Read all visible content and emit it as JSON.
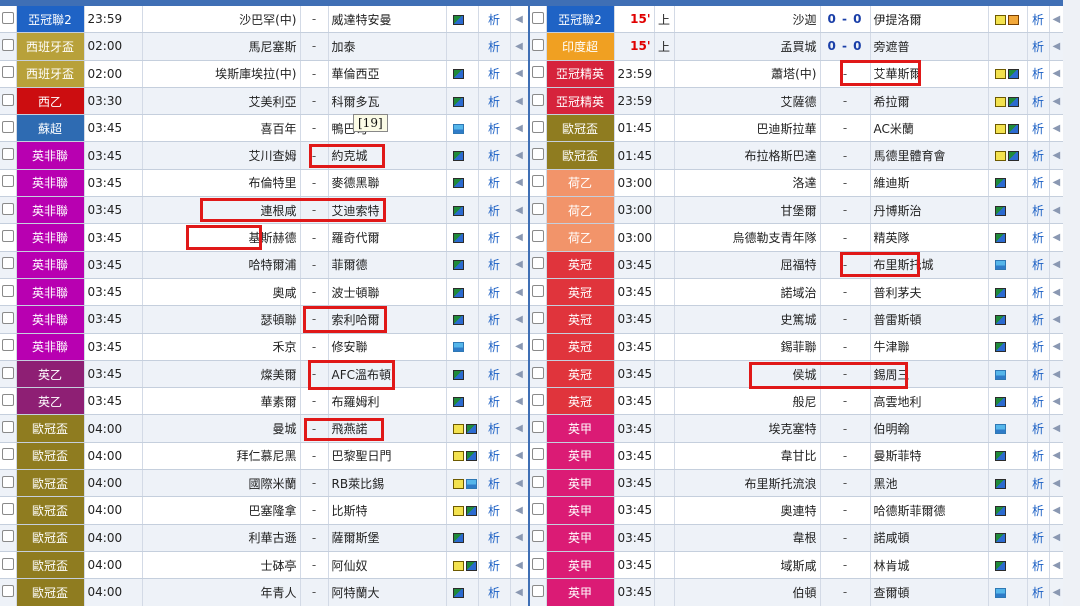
{
  "colors": {
    "亞冠聯2": "#1f63c5",
    "西班牙盃": "#b8a13a",
    "西乙": "#cc0d10",
    "蘇超": "#2e6bb2",
    "英非聯": "#b800b1",
    "英乙": "#8e1f74",
    "歐冠盃": "#8f7c20",
    "印度超": "#f0a022",
    "亞冠精英": "#d6233c",
    "荷乙": "#f2946a",
    "英冠": "#e0343c",
    "英甲": "#db1b75"
  },
  "tooltip": "[19]",
  "left_rows": [
    {
      "league": "亞冠聯2",
      "time": "23:59",
      "home": "沙巴罕(中)",
      "sep": "-",
      "away": "威達特安曼",
      "icons": [
        "field-icon"
      ],
      "analysis": "析"
    },
    {
      "league": "西班牙盃",
      "time": "02:00",
      "home": "馬尼塞斯",
      "sep": "-",
      "away": "加泰",
      "icons": [],
      "analysis": "析"
    },
    {
      "league": "西班牙盃",
      "time": "02:00",
      "home": "埃斯庫埃拉(中)",
      "sep": "-",
      "away": "華倫西亞",
      "icons": [
        "field-icon"
      ],
      "analysis": "析"
    },
    {
      "league": "西乙",
      "time": "03:30",
      "home": "艾美利亞",
      "sep": "-",
      "away": "科爾多瓦",
      "icons": [
        "field-icon"
      ],
      "analysis": "析"
    },
    {
      "league": "蘇超",
      "time": "03:45",
      "home": "喜百年",
      "sep": "-",
      "away": "鴨巴甸",
      "icons": [
        "sky-icon"
      ],
      "analysis": "析"
    },
    {
      "league": "英非聯",
      "time": "03:45",
      "home": "艾川查姆",
      "sep": "-",
      "away": "約克城",
      "icons": [
        "field-icon"
      ],
      "analysis": "析"
    },
    {
      "league": "英非聯",
      "time": "03:45",
      "home": "布倫特里",
      "sep": "-",
      "away": "麥德黑聯",
      "icons": [
        "field-icon"
      ],
      "analysis": "析"
    },
    {
      "league": "英非聯",
      "time": "03:45",
      "home": "連根咸",
      "sep": "-",
      "away": "艾迪索特",
      "icons": [
        "field-icon"
      ],
      "analysis": "析"
    },
    {
      "league": "英非聯",
      "time": "03:45",
      "home": "基斯赫德",
      "sep": "-",
      "away": "羅奇代爾",
      "icons": [
        "field-icon"
      ],
      "analysis": "析"
    },
    {
      "league": "英非聯",
      "time": "03:45",
      "home": "哈特爾浦",
      "sep": "-",
      "away": "菲爾德",
      "icons": [
        "field-icon"
      ],
      "analysis": "析"
    },
    {
      "league": "英非聯",
      "time": "03:45",
      "home": "奧咸",
      "sep": "-",
      "away": "波士頓聯",
      "icons": [
        "field-icon"
      ],
      "analysis": "析"
    },
    {
      "league": "英非聯",
      "time": "03:45",
      "home": "瑟頓聯",
      "sep": "-",
      "away": "索利哈爾",
      "icons": [
        "field-icon"
      ],
      "analysis": "析"
    },
    {
      "league": "英非聯",
      "time": "03:45",
      "home": "禾京",
      "sep": "-",
      "away": "修安聯",
      "icons": [
        "sky-icon"
      ],
      "analysis": "析"
    },
    {
      "league": "英乙",
      "time": "03:45",
      "home": "燦美爾",
      "sep": "-",
      "away": "AFC溫布頓",
      "icons": [
        "field-icon"
      ],
      "analysis": "析"
    },
    {
      "league": "英乙",
      "time": "03:45",
      "home": "華素爾",
      "sep": "-",
      "away": "布羅姆利",
      "icons": [
        "field-icon"
      ],
      "analysis": "析"
    },
    {
      "league": "歐冠盃",
      "time": "04:00",
      "home": "曼城",
      "sep": "-",
      "away": "飛燕諾",
      "icons": [
        "tv-icon",
        "field-icon"
      ],
      "analysis": "析"
    },
    {
      "league": "歐冠盃",
      "time": "04:00",
      "home": "拜仁慕尼黑",
      "sep": "-",
      "away": "巴黎聖日門",
      "icons": [
        "tv-icon",
        "field-icon"
      ],
      "analysis": "析"
    },
    {
      "league": "歐冠盃",
      "time": "04:00",
      "home": "國際米蘭",
      "sep": "-",
      "away": "RB萊比錫",
      "icons": [
        "tv-icon",
        "sky-icon"
      ],
      "analysis": "析"
    },
    {
      "league": "歐冠盃",
      "time": "04:00",
      "home": "巴塞隆拿",
      "sep": "-",
      "away": "比斯特",
      "icons": [
        "tv-icon",
        "field-icon"
      ],
      "analysis": "析"
    },
    {
      "league": "歐冠盃",
      "time": "04:00",
      "home": "利華古遜",
      "sep": "-",
      "away": "薩爾斯堡",
      "icons": [
        "field-icon"
      ],
      "analysis": "析"
    },
    {
      "league": "歐冠盃",
      "time": "04:00",
      "home": "士砵亭",
      "sep": "-",
      "away": "阿仙奴",
      "icons": [
        "tv-icon",
        "field-icon"
      ],
      "analysis": "析"
    },
    {
      "league": "歐冠盃",
      "time": "04:00",
      "home": "年青人",
      "sep": "-",
      "away": "阿特蘭大",
      "icons": [
        "field-icon"
      ],
      "analysis": "析"
    }
  ],
  "right_rows": [
    {
      "league": "亞冠聯2",
      "time": "15'",
      "half": "上",
      "home": "沙迦",
      "mid": "0 - 0",
      "away": "伊提洛爾",
      "icons": [
        "tv-icon",
        "tv2-icon"
      ],
      "analysis": "析"
    },
    {
      "league": "印度超",
      "time": "15'",
      "half": "上",
      "home": "孟買城",
      "mid": "0 - 0",
      "away": "旁遮普",
      "icons": [],
      "analysis": "析"
    },
    {
      "league": "亞冠精英",
      "time": "23:59",
      "half": "",
      "home": "蕭塔(中)",
      "mid": "-",
      "away": "艾華斯爾",
      "icons": [
        "tv-icon",
        "field-icon"
      ],
      "analysis": "析"
    },
    {
      "league": "亞冠精英",
      "time": "23:59",
      "half": "",
      "home": "艾薩德",
      "mid": "-",
      "away": "希拉爾",
      "icons": [
        "tv-icon",
        "field-icon"
      ],
      "analysis": "析"
    },
    {
      "league": "歐冠盃",
      "time": "01:45",
      "half": "",
      "home": "巴迪斯拉華",
      "mid": "-",
      "away": "AC米蘭",
      "icons": [
        "tv-icon",
        "field-icon"
      ],
      "analysis": "析"
    },
    {
      "league": "歐冠盃",
      "time": "01:45",
      "half": "",
      "home": "布拉格斯巴達",
      "mid": "-",
      "away": "馬德里體育會",
      "icons": [
        "tv-icon",
        "field-icon"
      ],
      "analysis": "析"
    },
    {
      "league": "荷乙",
      "time": "03:00",
      "half": "",
      "home": "洛達",
      "mid": "-",
      "away": "維迪斯",
      "icons": [
        "field-icon"
      ],
      "analysis": "析"
    },
    {
      "league": "荷乙",
      "time": "03:00",
      "half": "",
      "home": "甘堡爾",
      "mid": "-",
      "away": "丹博斯治",
      "icons": [
        "field-icon"
      ],
      "analysis": "析"
    },
    {
      "league": "荷乙",
      "time": "03:00",
      "half": "",
      "home": "烏德勒支青年隊",
      "mid": "-",
      "away": "精英隊",
      "icons": [
        "field-icon"
      ],
      "analysis": "析"
    },
    {
      "league": "英冠",
      "time": "03:45",
      "half": "",
      "home": "屈福特",
      "mid": "-",
      "away": "布里斯托城",
      "icons": [
        "sky-icon"
      ],
      "analysis": "析"
    },
    {
      "league": "英冠",
      "time": "03:45",
      "half": "",
      "home": "諾域治",
      "mid": "-",
      "away": "普利茅夫",
      "icons": [
        "field-icon"
      ],
      "analysis": "析"
    },
    {
      "league": "英冠",
      "time": "03:45",
      "half": "",
      "home": "史篤城",
      "mid": "-",
      "away": "普雷斯頓",
      "icons": [
        "field-icon"
      ],
      "analysis": "析"
    },
    {
      "league": "英冠",
      "time": "03:45",
      "half": "",
      "home": "錫菲聯",
      "mid": "-",
      "away": "牛津聯",
      "icons": [
        "field-icon"
      ],
      "analysis": "析"
    },
    {
      "league": "英冠",
      "time": "03:45",
      "half": "",
      "home": "侯城",
      "mid": "-",
      "away": "錫周三",
      "icons": [
        "sky-icon"
      ],
      "analysis": "析"
    },
    {
      "league": "英冠",
      "time": "03:45",
      "half": "",
      "home": "般尼",
      "mid": "-",
      "away": "高雲地利",
      "icons": [
        "field-icon"
      ],
      "analysis": "析"
    },
    {
      "league": "英甲",
      "time": "03:45",
      "half": "",
      "home": "埃克塞特",
      "mid": "-",
      "away": "伯明翰",
      "icons": [
        "sky-icon"
      ],
      "analysis": "析"
    },
    {
      "league": "英甲",
      "time": "03:45",
      "half": "",
      "home": "韋甘比",
      "mid": "-",
      "away": "曼斯菲特",
      "icons": [
        "field-icon"
      ],
      "analysis": "析"
    },
    {
      "league": "英甲",
      "time": "03:45",
      "half": "",
      "home": "布里斯托流浪",
      "mid": "-",
      "away": "黑池",
      "icons": [
        "field-icon"
      ],
      "analysis": "析"
    },
    {
      "league": "英甲",
      "time": "03:45",
      "half": "",
      "home": "奧連特",
      "mid": "-",
      "away": "哈德斯菲爾德",
      "icons": [
        "field-icon"
      ],
      "analysis": "析"
    },
    {
      "league": "英甲",
      "time": "03:45",
      "half": "",
      "home": "韋根",
      "mid": "-",
      "away": "諾咸頓",
      "icons": [
        "field-icon"
      ],
      "analysis": "析"
    },
    {
      "league": "英甲",
      "time": "03:45",
      "half": "",
      "home": "域斯咸",
      "mid": "-",
      "away": "林肯城",
      "icons": [
        "field-icon"
      ],
      "analysis": "析"
    },
    {
      "league": "英甲",
      "time": "03:45",
      "half": "",
      "home": "伯頓",
      "mid": "-",
      "away": "查爾頓",
      "icons": [
        "sky-icon"
      ],
      "analysis": "析"
    }
  ]
}
